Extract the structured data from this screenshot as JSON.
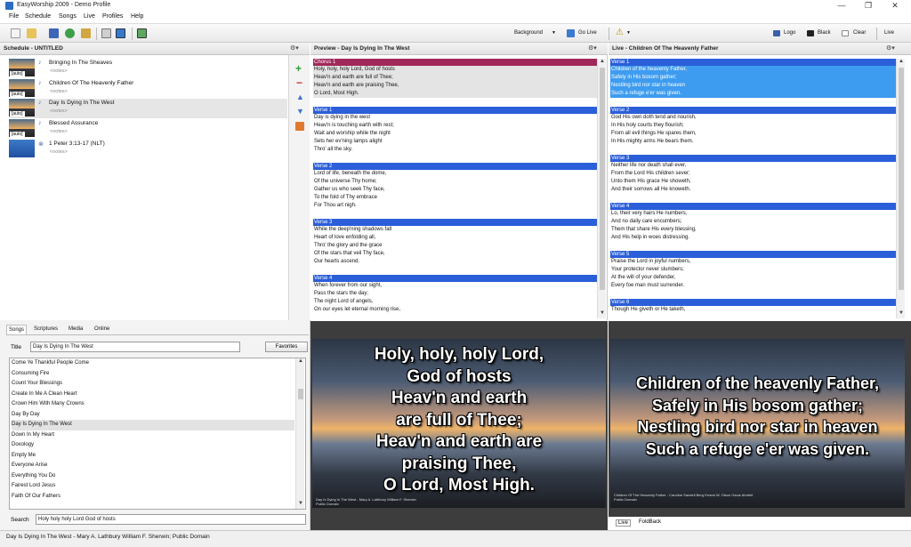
{
  "window": {
    "title": "EasyWorship 2009 - Demo Profile",
    "controls": [
      "—",
      "❐",
      "✕"
    ]
  },
  "menu": [
    "File",
    "Schedule",
    "Songs",
    "Live",
    "Profiles",
    "Help"
  ],
  "toolbar": {
    "background_label": "Background",
    "golive_label": "Go Live",
    "logo_label": "Logo",
    "black_label": "Black",
    "clear_label": "Clear",
    "live_label": "Live"
  },
  "schedule": {
    "title": "Schedule - UNTITLED",
    "items": [
      {
        "name": "Bringing In The Sheaves",
        "note": "<notes>",
        "tag": "[auto]",
        "thumb": "sunset"
      },
      {
        "name": "Children Of The Heavenly Father",
        "note": "<notes>",
        "tag": "[auto]",
        "thumb": "sunset"
      },
      {
        "name": "Day Is Dying In The West",
        "note": "<notes>",
        "tag": "[auto]",
        "thumb": "sunset"
      },
      {
        "name": "Blessed Assurance",
        "note": "<notes>",
        "tag": "[auto]",
        "thumb": "sunset"
      },
      {
        "name": "1 Peter 3:13-17 (NLT)",
        "note": "<notes>",
        "tag": "",
        "thumb": "blue"
      }
    ]
  },
  "preview": {
    "title": "Preview - Day Is Dying In The West",
    "blocks": [
      {
        "label": "Chorus 1",
        "kind": "chorus",
        "lines": [
          "Holy, holy, holy Lord, God of hosts",
          "Heav'n and earth are full of Thee;",
          "Heav'n and earth are praising Thee,",
          "O Lord, Most High."
        ]
      },
      {
        "label": "Verse 1",
        "kind": "verse",
        "lines": [
          "Day is dying in the west",
          "Heav'n is touching earth with rest;",
          "Wait and worship while the night",
          "Sets her ev'ning lamps alight",
          "Thro' all the sky."
        ]
      },
      {
        "label": "Verse 2",
        "kind": "verse",
        "lines": [
          "Lord of life, beneath the dome,",
          "Of the universe Thy home;",
          "Gather us who seek Thy face,",
          "To the fold of Thy embrace",
          "For Thou art nigh."
        ]
      },
      {
        "label": "Verse 3",
        "kind": "verse",
        "lines": [
          "While the deep'ning shadows fall",
          "Heart of love enfolding all,",
          "Thro' the glory and the grace",
          "Of the stars that veil Thy face,",
          "Our hearts ascend."
        ]
      },
      {
        "label": "Verse 4",
        "kind": "verse",
        "lines": [
          "When forever from our sight,",
          "Pass the stars the day;",
          "The night Lord of angels,",
          "On our eyes let eternal morning rise,"
        ]
      }
    ],
    "slide_text": "Holy, holy, holy Lord,\nGod of hosts\nHeav'n and earth\nare full of Thee;\nHeav'n and earth are\npraising Thee,\nO Lord, Most High.",
    "slide_footer": "Day Is Dying In The West - Mary A. Lathbury William F. Sherwin\nPublic Domain"
  },
  "live": {
    "title": "Live - Children Of The Heavenly Father",
    "blocks": [
      {
        "label": "Verse 1",
        "kind": "verse",
        "lines": [
          "Children of the heavenly Father,",
          "Safely in His bosom gather;",
          "Nestling bird nor star in heaven",
          "Such a refuge e'er was given."
        ]
      },
      {
        "label": "Verse 2",
        "kind": "verse",
        "lines": [
          "God His own doth tend and nourish,",
          "In His holy courts they flourish;",
          "From all evil things He spares them,",
          "In His mighty arms He bears them."
        ]
      },
      {
        "label": "Verse 3",
        "kind": "verse",
        "lines": [
          "Neither life nor death shall ever,",
          "From the Lord His children sever;",
          "Unto them His grace He showeth,",
          "And their sorrows all He knoweth."
        ]
      },
      {
        "label": "Verse 4",
        "kind": "verse",
        "lines": [
          "Lo, their very hairs He numbers,",
          "And no daily care encumbers;",
          "Them that share His every blessing,",
          "And His help in woes distressing."
        ]
      },
      {
        "label": "Verse 5",
        "kind": "verse",
        "lines": [
          "Praise the Lord in joyful numbers,",
          "Your protector never slumbers;",
          "At the will of your defender,",
          "Every foe man must surrender."
        ]
      },
      {
        "label": "Verse 6",
        "kind": "verse",
        "lines": [
          "Though He giveth or He taketh,"
        ]
      }
    ],
    "slide_text": "Children of the heavenly Father,\nSafely in His bosom gather;\nNestling bird nor star in heaven\nSuch a refuge e'er was given.",
    "slide_footer": "Children Of The Heavenly Father - Caroline Sandell Berg Ernest W. Olson Oscar Ahnfelt\nPublic Domain",
    "tabs": [
      "Live",
      "FoldBack"
    ]
  },
  "library": {
    "tabs": [
      "Songs",
      "Scriptures",
      "Media",
      "Online"
    ],
    "title_label": "Title",
    "title_value": "Day Is Dying In The West",
    "favorites_label": "Favorites",
    "songs": [
      "Come Ye Thankful People Come",
      "Consuming Fire",
      "Count Your Blessings",
      "Create In Me A Clean Heart",
      "Crown Him With Many Crowns",
      "Day By Day",
      "Day Is Dying In The West",
      "Down In My Heart",
      "Doxology",
      "Empty Me",
      "Everyone Arise",
      "Everything You Do",
      "Fairest Lord Jesus",
      "Faith Of Our Fathers"
    ],
    "selected_song": "Day Is Dying In The West",
    "search_label": "Search",
    "search_value": "Holy holy holy Lord God of hosts"
  },
  "status": {
    "text": "Day Is Dying In The West - Mary A. Lathbury William F. Sherwin; Public Domain"
  },
  "colors": {
    "verse_header": "#2b5fd9",
    "chorus_header": "#a0285a",
    "live_selection": "#3e9cf0"
  }
}
